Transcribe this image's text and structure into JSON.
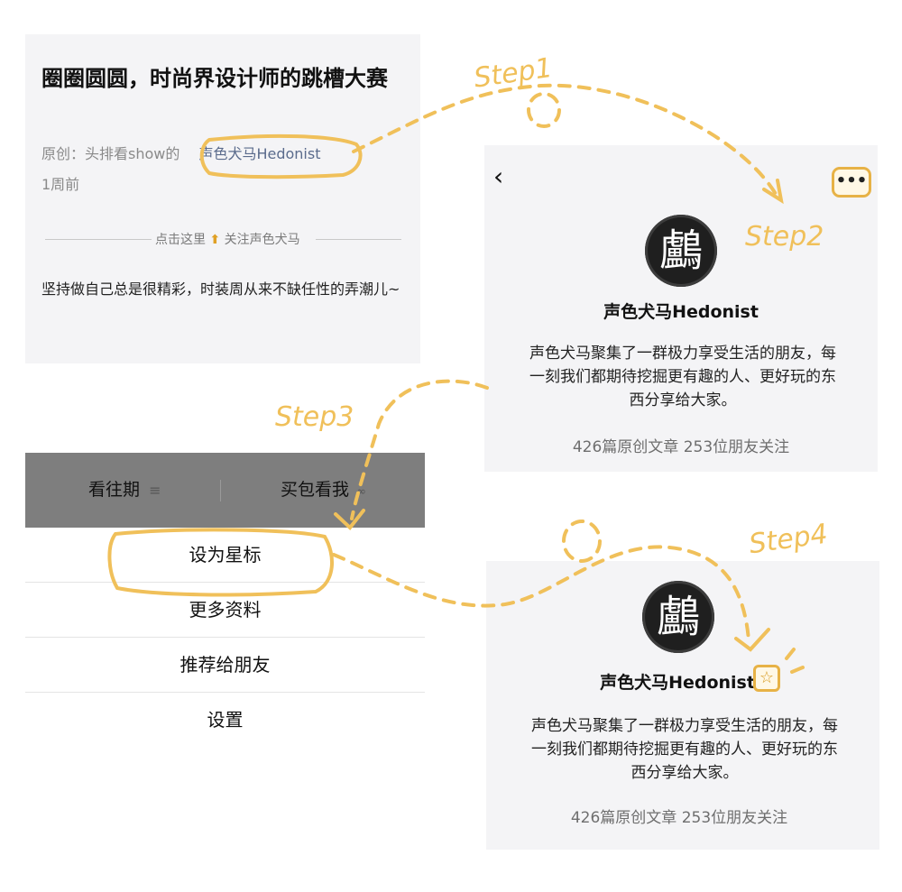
{
  "article": {
    "title": "圈圈圆圆，时尚界设计师的跳槽大赛",
    "meta_prefix": "原创：头排看show的",
    "author": "声色犬马Hedonist",
    "time": "1周前",
    "divider_text_left": "点击这里",
    "divider_arrow": "⬆",
    "divider_text_right": "关注声色犬马",
    "body": "坚持做自己总是很精彩，时装周从来不缺任性的弄潮儿~"
  },
  "profile": {
    "back_icon": "‹",
    "more_icon": "•••",
    "avatar_char": "鸕",
    "name": "声色犬马Hedonist",
    "description": "声色犬马聚集了一群极力享受生活的朋友，每一刻我们都期待挖掘更有趣的人、更好玩的东西分享给大家。",
    "stats": "426篇原创文章 253位朋友关注"
  },
  "profile_starred": {
    "avatar_char": "鸕",
    "name": "声色犬马Hedonist",
    "star_icon": "☆",
    "description": "声色犬马聚集了一群极力享受生活的朋友，每一刻我们都期待挖掘更有趣的人、更好玩的东西分享给大家。",
    "stats": "426篇原创文章 253位朋友关注"
  },
  "menu": {
    "tabs": [
      {
        "label": "看往期",
        "icon": "≡"
      },
      {
        "label": "买包看我",
        "icon": "🔗"
      }
    ],
    "items": [
      "设为星标",
      "更多资料",
      "推荐给朋友",
      "设置"
    ]
  },
  "steps": [
    "Step1",
    "Step2",
    "Step3",
    "Step4"
  ],
  "colors": {
    "accent": "#f0c05a",
    "highlight_border": "#e7b246",
    "panel_bg": "#f4f4f6"
  }
}
